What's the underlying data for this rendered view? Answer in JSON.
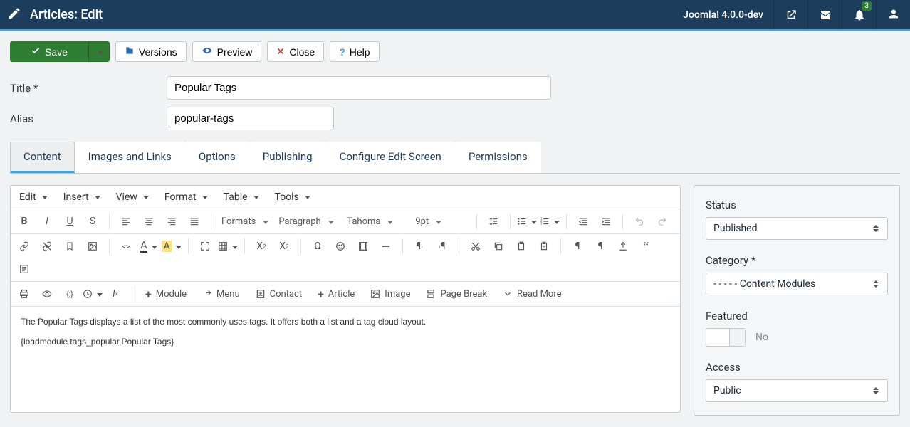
{
  "header": {
    "title": "Articles: Edit",
    "brand": "Joomla! 4.0.0-dev",
    "notif_count": "3"
  },
  "toolbar": {
    "save_label": "Save",
    "versions_label": "Versions",
    "preview_label": "Preview",
    "close_label": "Close",
    "help_label": "Help"
  },
  "fields": {
    "title_label": "Title *",
    "title_value": "Popular Tags",
    "alias_label": "Alias",
    "alias_value": "popular-tags"
  },
  "tabs": [
    {
      "label": "Content",
      "active": true
    },
    {
      "label": "Images and Links",
      "active": false
    },
    {
      "label": "Options",
      "active": false
    },
    {
      "label": "Publishing",
      "active": false
    },
    {
      "label": "Configure Edit Screen",
      "active": false
    },
    {
      "label": "Permissions",
      "active": false
    }
  ],
  "editor": {
    "menu": {
      "edit": "Edit",
      "insert": "Insert",
      "view": "View",
      "format": "Format",
      "table": "Table",
      "tools": "Tools"
    },
    "selects": {
      "formats": "Formats",
      "block": "Paragraph",
      "font": "Tahoma",
      "size": "9pt"
    },
    "buttons": {
      "module": "Module",
      "menu": "Menu",
      "contact": "Contact",
      "article": "Article",
      "image": "Image",
      "pagebreak": "Page Break",
      "readmore": "Read More"
    },
    "content_line1": "The Popular Tags displays a list of the most commonly uses tags. It offers both a list and a tag cloud layout.",
    "content_line2": "{loadmodule tags_popular,Popular Tags}"
  },
  "sidebar": {
    "status_label": "Status",
    "status_value": "Published",
    "category_label": "Category *",
    "category_value": "- - - - - Content Modules",
    "featured_label": "Featured",
    "featured_value": "No",
    "access_label": "Access",
    "access_value": "Public"
  }
}
